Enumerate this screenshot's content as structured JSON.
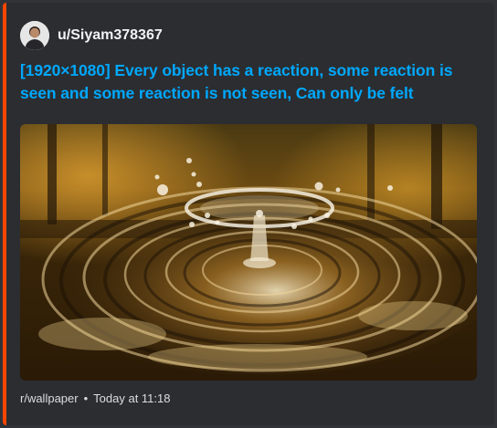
{
  "post": {
    "author": "u/Siyam378367",
    "title": "[1920×1080] Every object has a reaction, some reaction is seen and some reaction is not seen, Can only be felt",
    "subreddit": "r/wallpaper",
    "separator": "•",
    "timestamp": "Today at 11:18"
  },
  "colors": {
    "accent": "#ff4500",
    "title_link": "#00a8fc",
    "background": "#313338",
    "embed_background": "#2b2d31"
  },
  "icons": {
    "avatar": "user-avatar",
    "image": "water-drop-splash-photo"
  }
}
